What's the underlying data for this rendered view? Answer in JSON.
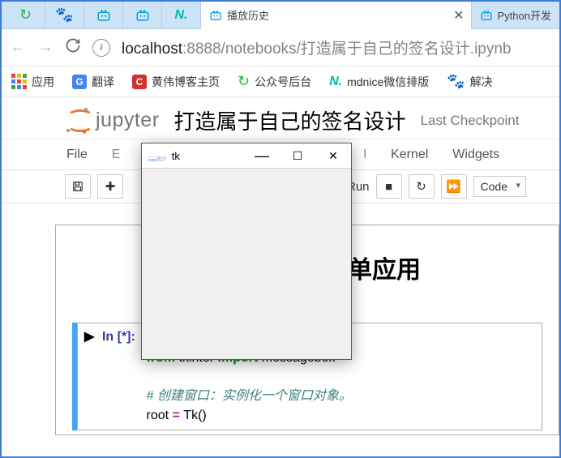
{
  "tabs": {
    "active_label": "播放历史",
    "trailing_label": "Python开发"
  },
  "url": {
    "host": "localhost",
    "port": ":8888",
    "path": "/notebooks/打造属于自己的签名设计.ipynb"
  },
  "bookmarks": {
    "apps": "应用",
    "translate": "翻译",
    "blog": "黄伟博客主页",
    "wechat": "公众号后台",
    "mdnice": "mdnice微信排版",
    "solve": "解决"
  },
  "jupyter": {
    "logo": "jupyter",
    "title": "打造属于自己的签名设计",
    "checkpoint": "Last Checkpoint"
  },
  "menu": {
    "file": "File",
    "e": "E",
    "l": "l",
    "kernel": "Kernel",
    "widgets": "Widgets"
  },
  "toolbar": {
    "run": "Run",
    "celltype": "Code"
  },
  "heading_fragment": "单应用",
  "cell": {
    "prompt_label": "In ",
    "prompt_counter": "[*]:",
    "line1_partial": "____ _______ ______ ",
    "line1_star": "*",
    "line2_from": "from",
    "line2_mod": " tkinter ",
    "line2_import": "import",
    "line2_name": " messagebox",
    "comment": "# 创建窗口：实例化一个窗口对象。",
    "line4_lhs": "root ",
    "line4_eq": "= ",
    "line4_rhs": "Tk()"
  },
  "tk": {
    "title": "tk"
  }
}
